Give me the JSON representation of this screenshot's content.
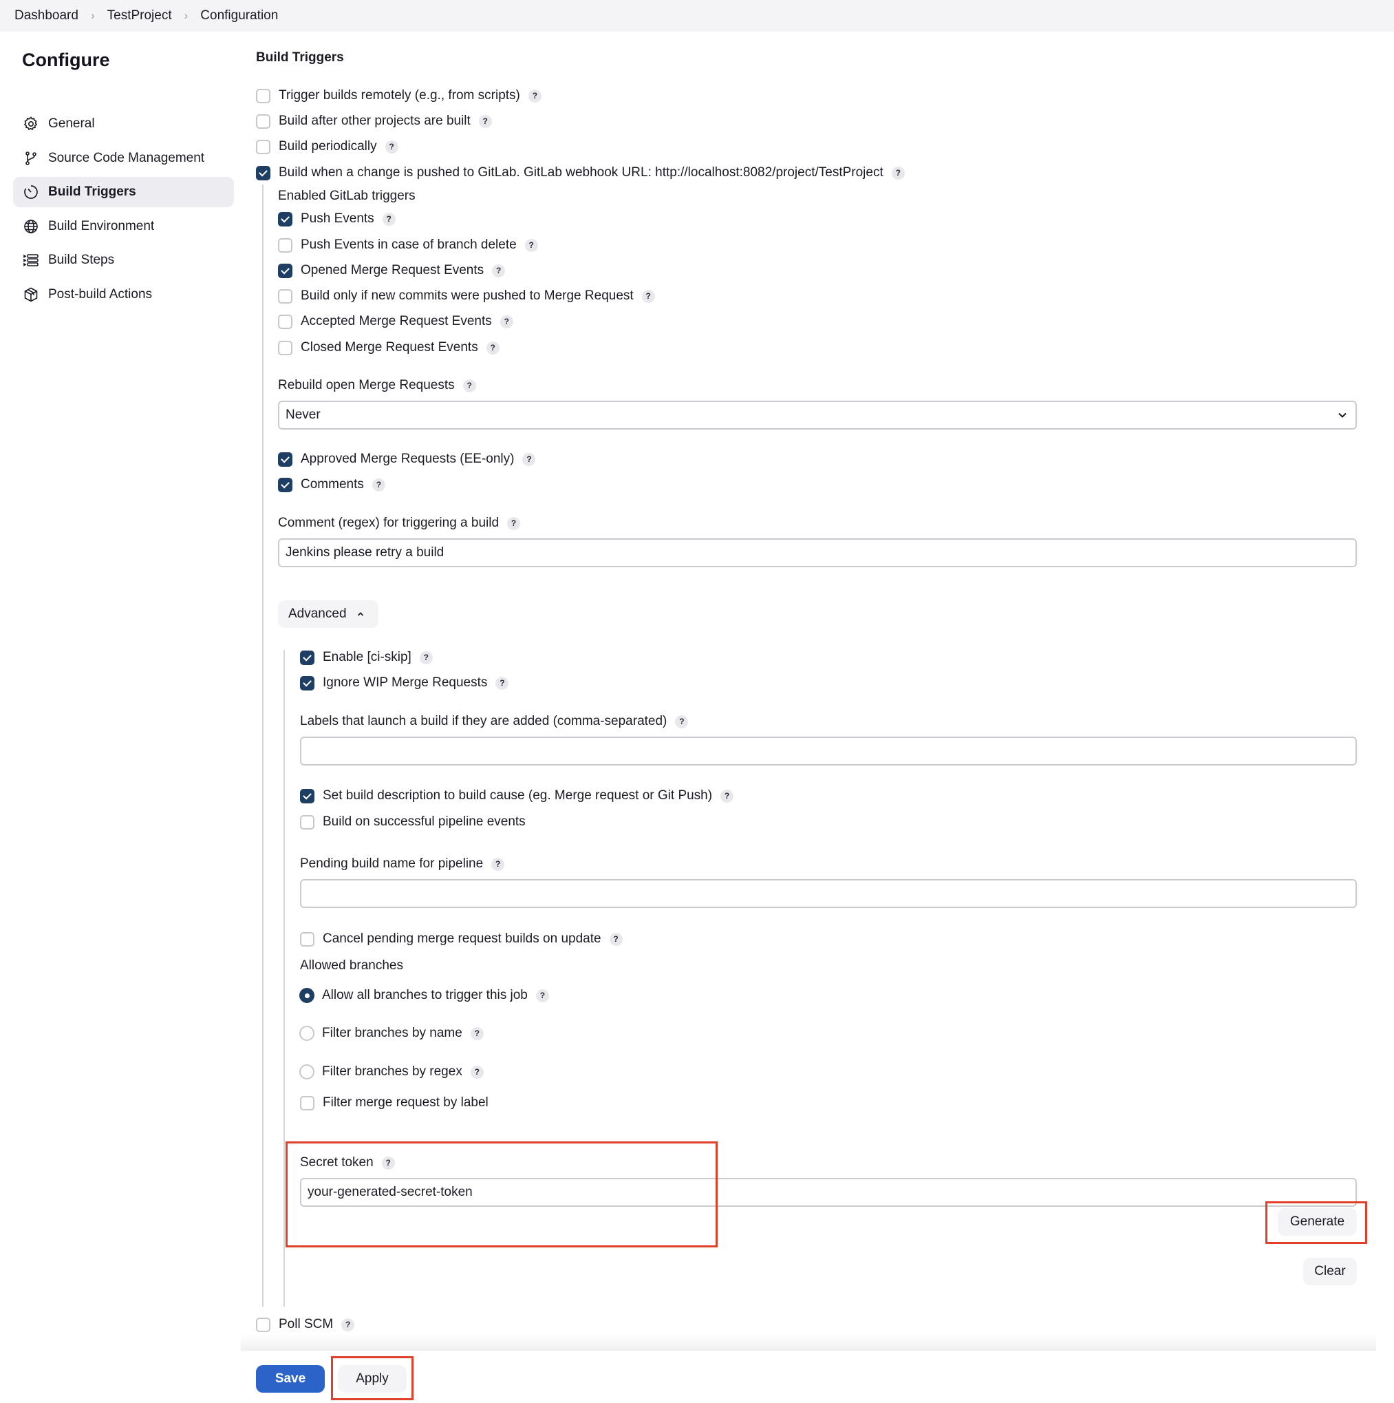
{
  "breadcrumb": {
    "items": [
      "Dashboard",
      "TestProject",
      "Configuration"
    ],
    "separator_icon": "chevron-right-icon"
  },
  "sidebar": {
    "title": "Configure",
    "items": [
      {
        "label": "General",
        "icon": "gear-icon",
        "active": false
      },
      {
        "label": "Source Code Management",
        "icon": "git-branch-icon",
        "active": false
      },
      {
        "label": "Build Triggers",
        "icon": "timer-icon",
        "active": true
      },
      {
        "label": "Build Environment",
        "icon": "globe-icon",
        "active": false
      },
      {
        "label": "Build Steps",
        "icon": "list-steps-icon",
        "active": false
      },
      {
        "label": "Post-build Actions",
        "icon": "package-icon",
        "active": false
      }
    ]
  },
  "build_triggers": {
    "title": "Build Triggers",
    "top_options": [
      {
        "label": "Trigger builds remotely (e.g., from scripts)",
        "checked": false,
        "help": true
      },
      {
        "label": "Build after other projects are built",
        "checked": false,
        "help": true
      },
      {
        "label": "Build periodically",
        "checked": false,
        "help": true
      },
      {
        "label": "Build when a change is pushed to GitLab. GitLab webhook URL: http://localhost:8082/project/TestProject",
        "checked": true,
        "help": true
      }
    ],
    "gitlab": {
      "enabled_triggers_label": "Enabled GitLab triggers",
      "triggers": [
        {
          "label": "Push Events",
          "checked": true,
          "help": true
        },
        {
          "label": "Push Events in case of branch delete",
          "checked": false,
          "help": true
        },
        {
          "label": "Opened Merge Request Events",
          "checked": true,
          "help": true
        },
        {
          "label": "Build only if new commits were pushed to Merge Request",
          "checked": false,
          "help": true
        },
        {
          "label": "Accepted Merge Request Events",
          "checked": false,
          "help": true
        },
        {
          "label": "Closed Merge Request Events",
          "checked": false,
          "help": true
        }
      ],
      "rebuild_label": "Rebuild open Merge Requests",
      "rebuild_value": "Never",
      "approved_mr": {
        "label": "Approved Merge Requests (EE-only)",
        "checked": true
      },
      "comments": {
        "label": "Comments",
        "checked": true
      },
      "comment_regex_label": "Comment (regex) for triggering a build",
      "comment_regex_value": "Jenkins please retry a build",
      "advanced_label": "Advanced",
      "advanced": {
        "ci_skip": {
          "label": "Enable [ci-skip]",
          "checked": true
        },
        "ignore_wip": {
          "label": "Ignore WIP Merge Requests",
          "checked": true
        },
        "labels_label": "Labels that launch a build if they are added (comma-separated)",
        "labels_value": "",
        "set_description": {
          "label": "Set build description to build cause (eg. Merge request or Git Push)",
          "checked": true
        },
        "build_on_pipeline": {
          "label": "Build on successful pipeline events",
          "checked": false
        },
        "pending_name_label": "Pending build name for pipeline",
        "pending_name_value": "",
        "cancel_pending": {
          "label": "Cancel pending merge request builds on update",
          "checked": false
        },
        "allowed_branches_label": "Allowed branches",
        "branch_options": [
          {
            "label": "Allow all branches to trigger this job",
            "selected": true,
            "help": true
          },
          {
            "label": "Filter branches by name",
            "selected": false,
            "help": true
          },
          {
            "label": "Filter branches by regex",
            "selected": false,
            "help": true
          }
        ],
        "filter_by_label": {
          "label": "Filter merge request by label",
          "checked": false
        },
        "secret_token_label": "Secret token",
        "secret_token_value": "your-generated-secret-token",
        "generate_label": "Generate",
        "clear_label": "Clear"
      }
    },
    "poll_scm": {
      "label": "Poll SCM",
      "checked": false
    }
  },
  "footer": {
    "save_label": "Save",
    "apply_label": "Apply"
  },
  "colors": {
    "accent": "#2b63c9",
    "checkbox_checked": "#1e3f63",
    "highlight": "#e0402a"
  }
}
